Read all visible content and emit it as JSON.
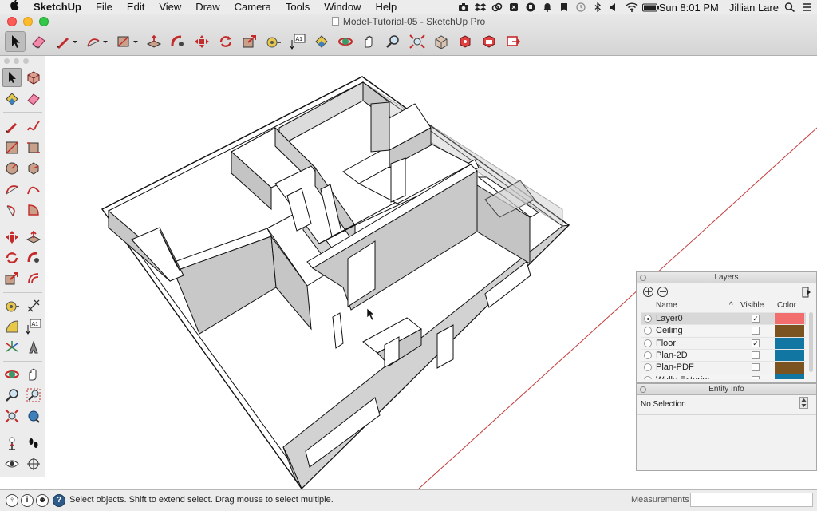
{
  "menubar": {
    "app": "SketchUp",
    "items": [
      "File",
      "Edit",
      "View",
      "Draw",
      "Camera",
      "Tools",
      "Window",
      "Help"
    ],
    "clock": "Sun 8:01 PM",
    "user": "Jillian Lare"
  },
  "window": {
    "title": "Model-Tutorial-05 - SketchUp Pro"
  },
  "toolbar": {
    "tools": [
      "select-icon",
      "eraser-icon",
      "pencil-icon",
      "arc-icon",
      "rectangle-icon",
      "push-pull-icon",
      "follow-me-icon",
      "move-icon",
      "rotate-icon",
      "scale-icon",
      "tape-measure-icon",
      "text-icon",
      "paint-bucket-icon",
      "orbit-icon",
      "pan-icon",
      "zoom-icon",
      "zoom-extents-icon",
      "3d-warehouse-icon",
      "extension-warehouse-icon",
      "layout-icon",
      "send-to-layout-icon"
    ],
    "text_tool_label": "A1"
  },
  "palette": {
    "text_tool_label": "A1"
  },
  "layers_panel": {
    "title": "Layers",
    "columns": {
      "name": "Name",
      "visible": "Visible",
      "color": "Color"
    },
    "rows": [
      {
        "name": "Layer0",
        "active": true,
        "visible": true,
        "color": "#f26e6e"
      },
      {
        "name": "Ceiling",
        "active": false,
        "visible": false,
        "color": "#7a5320"
      },
      {
        "name": "Floor",
        "active": false,
        "visible": true,
        "color": "#1276a3"
      },
      {
        "name": "Plan-2D",
        "active": false,
        "visible": false,
        "color": "#1276a3"
      },
      {
        "name": "Plan-PDF",
        "active": false,
        "visible": false,
        "color": "#7a5320"
      },
      {
        "name": "Walls-Exterior",
        "active": false,
        "visible": false,
        "color": "#1276a3"
      }
    ]
  },
  "entity_info": {
    "title": "Entity Info",
    "selection": "No Selection"
  },
  "statusbar": {
    "message": "Select objects. Shift to extend select. Drag mouse to select multiple.",
    "measurements_label": "Measurements",
    "measurements_value": ""
  }
}
